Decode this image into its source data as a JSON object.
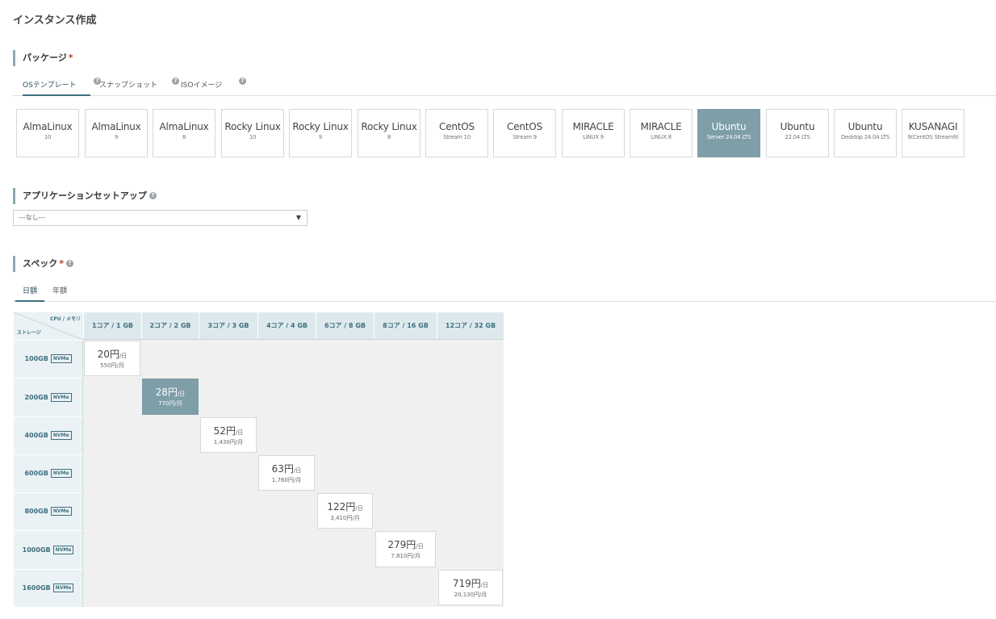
{
  "page_title": "インスタンス作成",
  "package": {
    "title": "パッケージ",
    "required_mark": "*",
    "tabs": [
      {
        "label": "OSテンプレート",
        "help": "?"
      },
      {
        "label": "スナップショット",
        "help": "?"
      },
      {
        "label": "ISOイメージ",
        "help": "?"
      }
    ],
    "os_options": [
      {
        "name": "AlmaLinux",
        "version": "10"
      },
      {
        "name": "AlmaLinux",
        "version": "9"
      },
      {
        "name": "AlmaLinux",
        "version": "8"
      },
      {
        "name": "Rocky Linux",
        "version": "10"
      },
      {
        "name": "Rocky Linux",
        "version": "9"
      },
      {
        "name": "Rocky Linux",
        "version": "8"
      },
      {
        "name": "CentOS",
        "version": "Stream 10"
      },
      {
        "name": "CentOS",
        "version": "Stream 9"
      },
      {
        "name": "MIRACLE",
        "version": "LINUX 9"
      },
      {
        "name": "MIRACLE",
        "version": "LINUX 8"
      },
      {
        "name": "Ubuntu",
        "version": "Server 24.04 LTS"
      },
      {
        "name": "Ubuntu",
        "version": "22.04 LTS"
      },
      {
        "name": "Ubuntu",
        "version": "Desktop 24.04 LTS"
      },
      {
        "name": "KUSANAGI",
        "version": "9(CentOS Stream9)"
      }
    ],
    "selected_index": 10
  },
  "app_setup": {
    "title": "アプリケーションセットアップ",
    "help": "?",
    "selected_value": "---なし---",
    "arrow": "▼"
  },
  "spec": {
    "title": "スペック",
    "required_mark": "*",
    "help": "?",
    "tabs": [
      "日額",
      "年額"
    ],
    "corner_cpu_label": "CPU / メモリ",
    "corner_storage_label": "ストレージ",
    "columns": [
      "1コア / 1 GB",
      "2コア / 2 GB",
      "3コア / 3 GB",
      "4コア / 4 GB",
      "6コア / 8 GB",
      "8コア / 16 GB",
      "12コア / 32 GB"
    ],
    "storage_badge": "NVMe",
    "rows": [
      "100GB",
      "200GB",
      "400GB",
      "600GB",
      "800GB",
      "1000GB",
      "1600GB"
    ],
    "per_day_suffix": "/日",
    "prices": [
      {
        "day": "20円",
        "month": "550円/月"
      },
      {
        "day": "28円",
        "month": "770円/月"
      },
      {
        "day": "52円",
        "month": "1,430円/月"
      },
      {
        "day": "63円",
        "month": "1,760円/月"
      },
      {
        "day": "122円",
        "month": "3,410円/月"
      },
      {
        "day": "279円",
        "month": "7,810円/月"
      },
      {
        "day": "719円",
        "month": "20,130円/月"
      }
    ],
    "selected_price_index": 1
  }
}
